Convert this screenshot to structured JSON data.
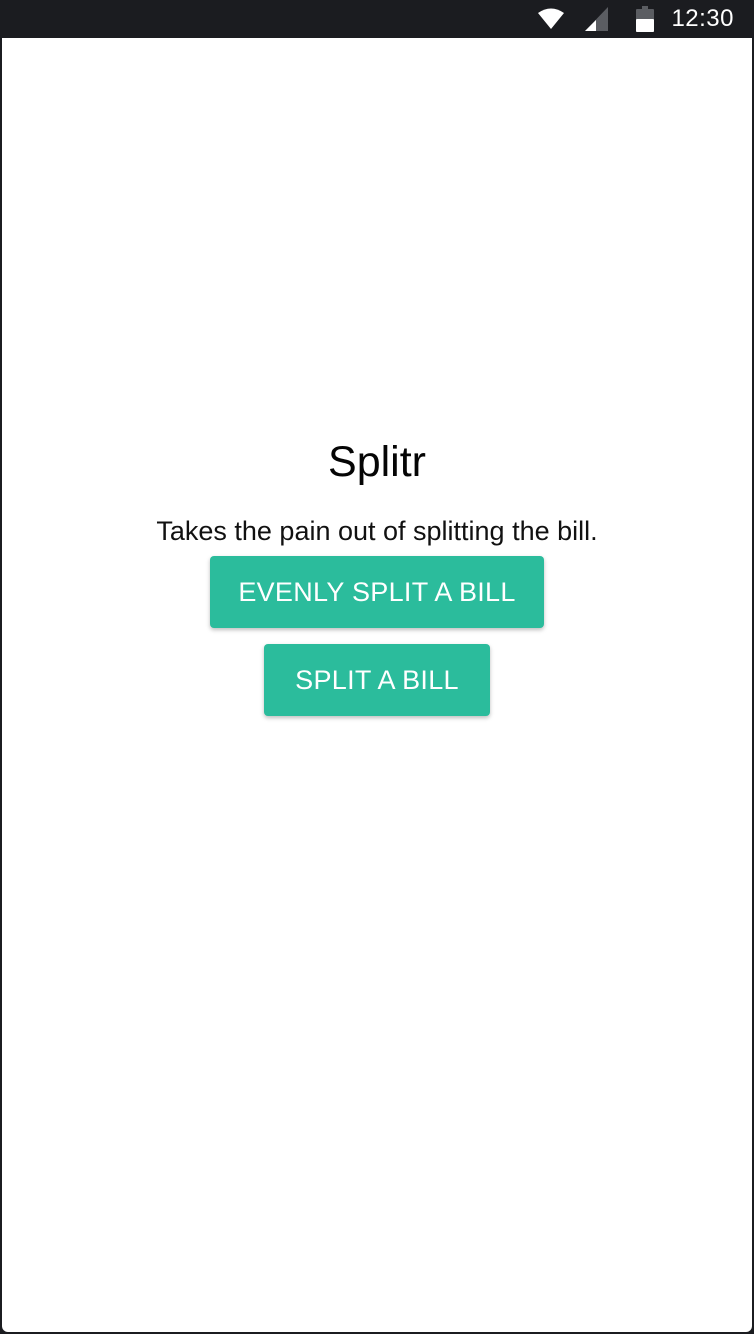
{
  "status_bar": {
    "time": "12:30",
    "icons": [
      "wifi-icon",
      "signal-icon",
      "battery-icon"
    ],
    "background_color": "#1b1c20"
  },
  "app": {
    "title": "Splitr",
    "tagline": "Takes the pain out of splitting the bill.",
    "accent_color": "#2bbc9c"
  },
  "actions": {
    "evenly_split_label": "EVENLY SPLIT A BILL",
    "split_label": "SPLIT A BILL"
  }
}
